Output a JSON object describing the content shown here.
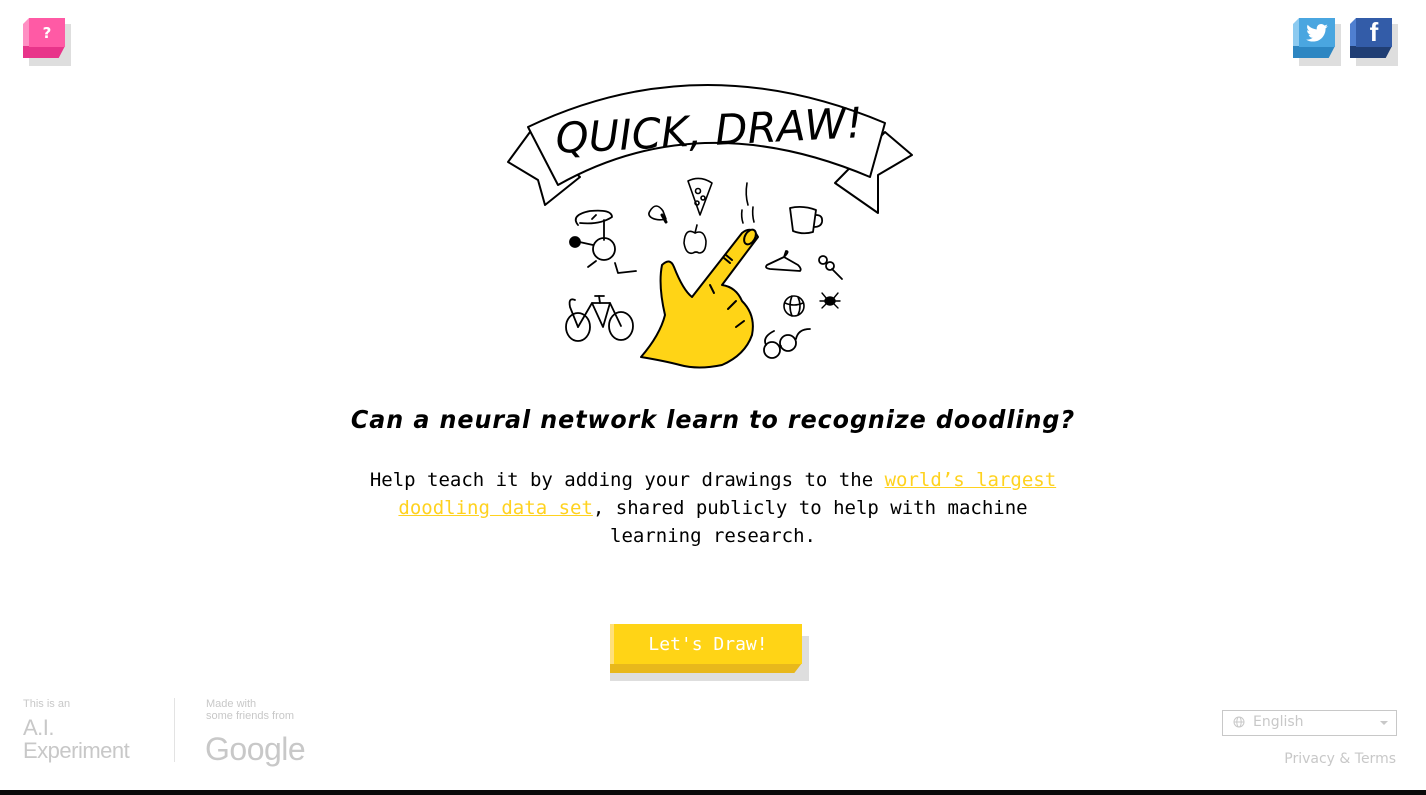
{
  "header": {
    "help_label": "?",
    "twitter_icon": "twitter-icon",
    "facebook_label": "f"
  },
  "hero": {
    "title": "QUICK, DRAW!",
    "doodles": [
      "helicopter",
      "lightbulb",
      "pizza",
      "apple",
      "pointing-hand",
      "mug",
      "hanger",
      "pushpin",
      "bicycle",
      "basketball",
      "spider",
      "eyeglasses"
    ]
  },
  "main": {
    "headline": "Can a neural network learn to recognize doodling?",
    "intro_before": "Help teach it by adding your drawings to the ",
    "intro_link": "world’s largest doodling data set",
    "intro_after": ", shared publicly to help with machine learning research.",
    "cta_label": "Let's Draw!"
  },
  "footer": {
    "ai_small": "This is an",
    "ai_line1": "A.I.",
    "ai_line2": "Experiment",
    "made_with_1": "Made with",
    "made_with_2": "some friends from",
    "google": "Google",
    "language": "English",
    "privacy": "Privacy & Terms"
  },
  "colors": {
    "accent_yellow": "#ffd416",
    "help_pink": "#ff5aa5",
    "twitter_blue": "#4aa6e0",
    "facebook_blue": "#335ca8",
    "footer_gray": "#c8c8c8"
  }
}
